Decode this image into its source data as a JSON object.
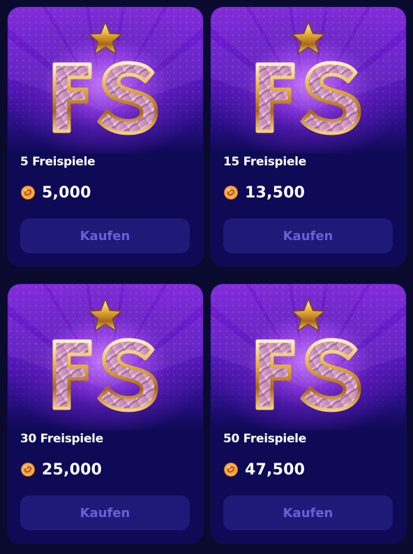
{
  "colors": {
    "page_background": "#090a2e",
    "card_background": "#0e0a55",
    "art_purple": "#7a1fd6",
    "button_background": "#1f1a78",
    "button_text": "#6a5fd6",
    "gold": "#e8b43a",
    "coin_orange": "#e0781a"
  },
  "icons": {
    "star": "star-icon",
    "logo": "fs-logo",
    "coin": "coin-icon"
  },
  "offers": [
    {
      "title": "5 Freispiele",
      "price": "5,000",
      "button_label": "Kaufen"
    },
    {
      "title": "15 Freispiele",
      "price": "13,500",
      "button_label": "Kaufen"
    },
    {
      "title": "30 Freispiele",
      "price": "25,000",
      "button_label": "Kaufen"
    },
    {
      "title": "50 Freispiele",
      "price": "47,500",
      "button_label": "Kaufen"
    }
  ]
}
